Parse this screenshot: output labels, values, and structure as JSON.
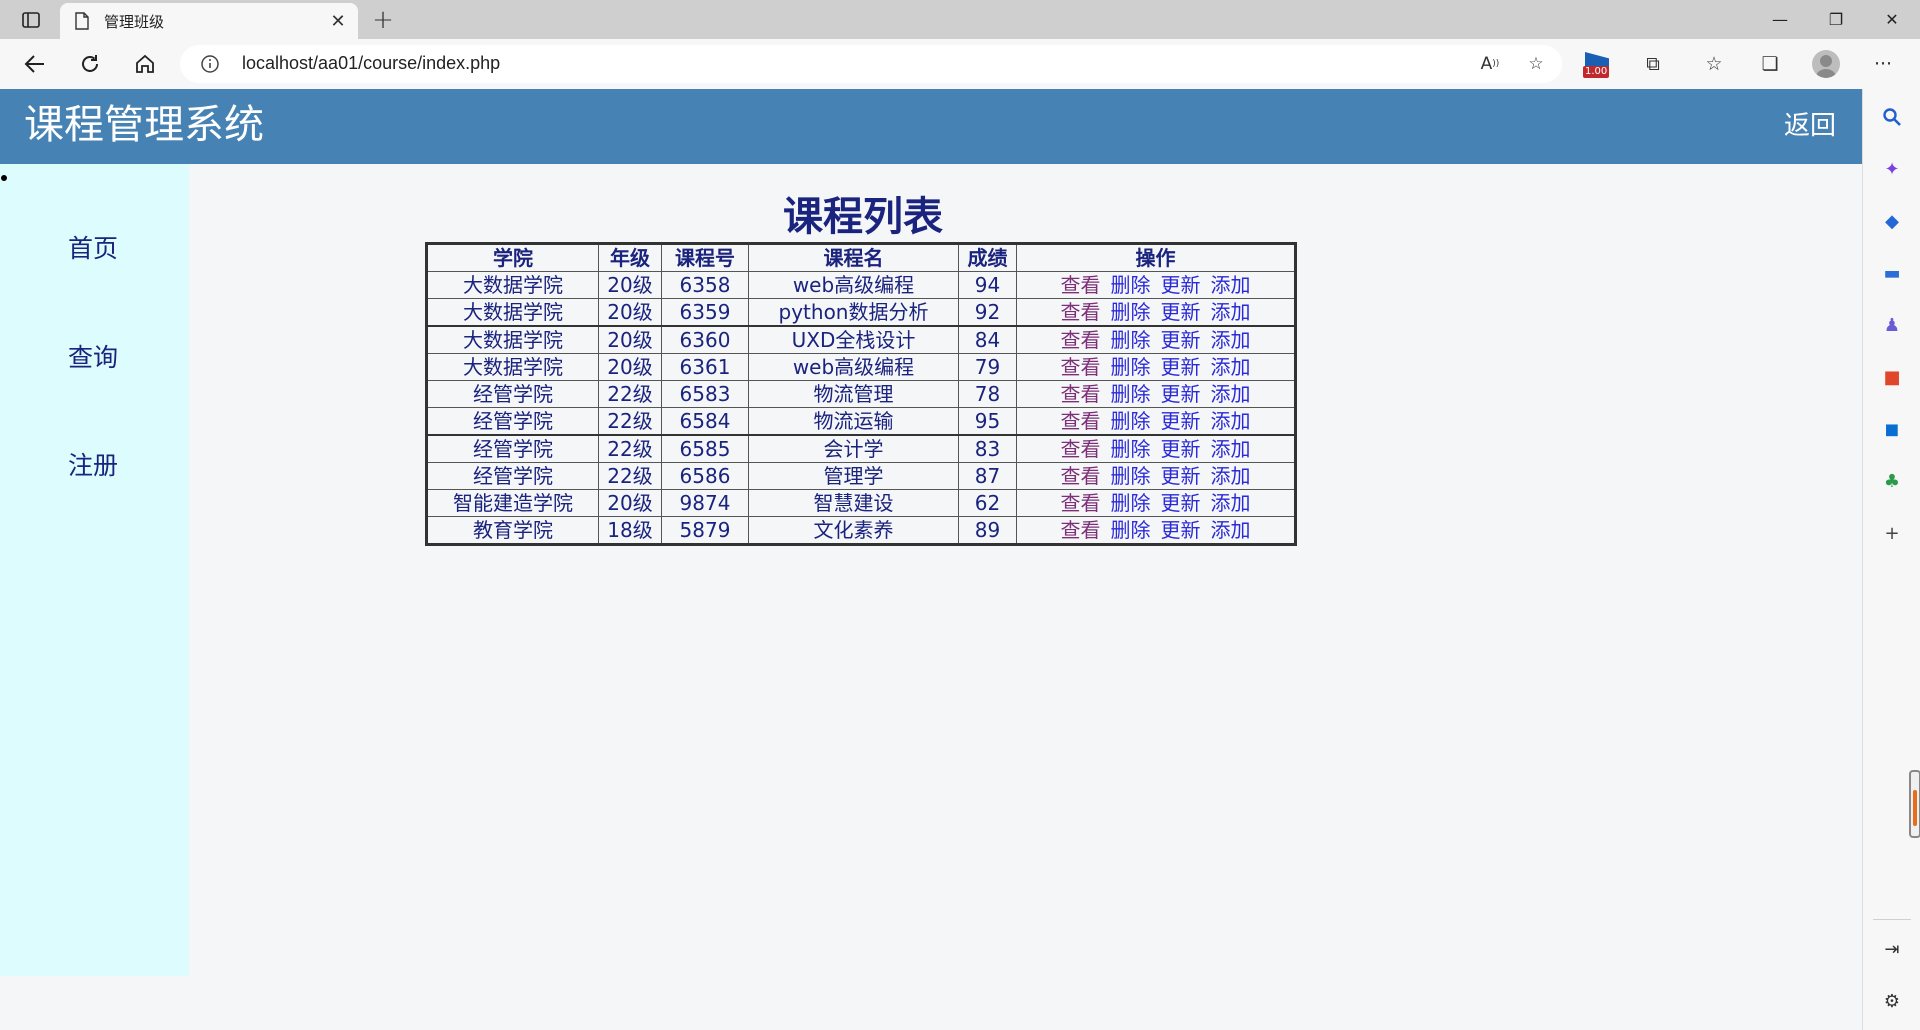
{
  "browser": {
    "tab_title": "管理班级",
    "tab_close": "✕",
    "new_tab": "+",
    "url": "localhost/aa01/course/index.php",
    "window_minimize": "—",
    "window_restore": "❐",
    "window_close": "✕",
    "extension_badge": "1.00",
    "more": "···"
  },
  "header": {
    "site_title": "课程管理系统",
    "back_label": "返回"
  },
  "sidebar": {
    "items": [
      {
        "label": "首页"
      },
      {
        "label": "查询"
      },
      {
        "label": "注册"
      }
    ]
  },
  "main": {
    "title": "课程列表",
    "columns": [
      "学院",
      "年级",
      "课程号",
      "课程名",
      "成绩",
      "操作"
    ],
    "actions": [
      "查看",
      "删除",
      "更新",
      "添加"
    ],
    "rows": [
      {
        "college": "大数据学院",
        "grade": "20级",
        "course_id": "6358",
        "course_name": "web高级编程",
        "score": "94"
      },
      {
        "college": "大数据学院",
        "grade": "20级",
        "course_id": "6359",
        "course_name": "python数据分析",
        "score": "92"
      },
      {
        "college": "大数据学院",
        "grade": "20级",
        "course_id": "6360",
        "course_name": "UXD全栈设计",
        "score": "84"
      },
      {
        "college": "大数据学院",
        "grade": "20级",
        "course_id": "6361",
        "course_name": "web高级编程",
        "score": "79"
      },
      {
        "college": "经管学院",
        "grade": "22级",
        "course_id": "6583",
        "course_name": "物流管理",
        "score": "78"
      },
      {
        "college": "经管学院",
        "grade": "22级",
        "course_id": "6584",
        "course_name": "物流运输",
        "score": "95"
      },
      {
        "college": "经管学院",
        "grade": "22级",
        "course_id": "6585",
        "course_name": "会计学",
        "score": "83"
      },
      {
        "college": "经管学院",
        "grade": "22级",
        "course_id": "6586",
        "course_name": "管理学",
        "score": "87"
      },
      {
        "college": "智能建造学院",
        "grade": "20级",
        "course_id": "9874",
        "course_name": "智慧建设",
        "score": "62"
      },
      {
        "college": "教育学院",
        "grade": "18级",
        "course_id": "5879",
        "course_name": "文化素养",
        "score": "89"
      }
    ]
  },
  "colors": {
    "header_bg": "#4782b4",
    "sidebar_bg": "#dcfcfe",
    "text_navy": "#1a237e"
  }
}
